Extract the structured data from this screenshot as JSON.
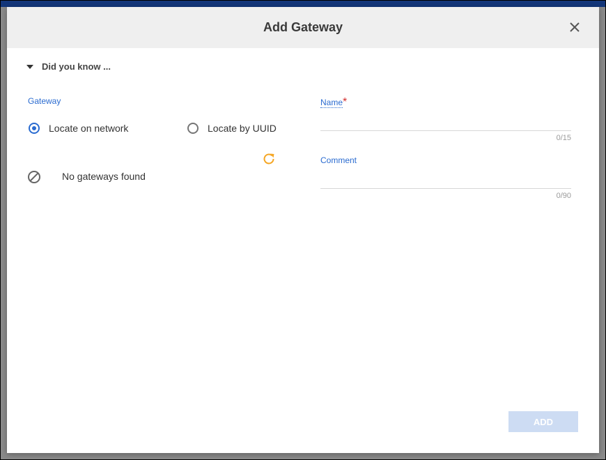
{
  "dialog": {
    "title": "Add Gateway",
    "did_you_know": "Did you know ...",
    "gateway_label": "Gateway",
    "radio_network": "Locate on network",
    "radio_uuid": "Locate by UUID",
    "selected_option": "Locate on network",
    "no_gateways": "No gateways found",
    "name_label": "Name",
    "name_required_mark": "*",
    "name_value": "",
    "name_counter": "0/15",
    "comment_label": "Comment",
    "comment_value": "",
    "comment_counter": "0/90",
    "add_button": "ADD"
  },
  "icons": {
    "close": "close-icon",
    "caret": "caret-down-icon",
    "refresh": "refresh-icon",
    "no_gateways": "block-icon"
  },
  "colors": {
    "accent": "#2a6bd0",
    "refresh": "#f5a623",
    "required": "#d32f2f",
    "add_button_disabled": "#cddcf3",
    "header_bg": "#efefef"
  }
}
